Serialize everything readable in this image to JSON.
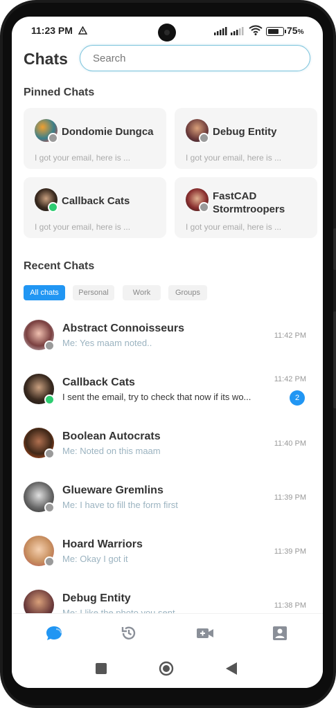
{
  "status": {
    "time": "11:23 PM",
    "battery": "75"
  },
  "header": {
    "title": "Chats",
    "search_placeholder": "Search"
  },
  "pinned": {
    "heading": "Pinned Chats",
    "items": [
      {
        "name": "Dondomie Dungca",
        "message": "I got your email, here is ...",
        "online": false
      },
      {
        "name": "Debug Entity",
        "message": "I got your email, here is ...",
        "online": false
      },
      {
        "name": "Callback Cats",
        "message": "I got your email, here is ...",
        "online": true
      },
      {
        "name": "FastCAD Stormtroopers",
        "message": "I got your email, here is ...",
        "online": false
      }
    ]
  },
  "recent": {
    "heading": "Recent Chats",
    "filters": [
      "All chats",
      "Personal",
      "Work",
      "Groups"
    ],
    "items": [
      {
        "name": "Abstract Connoisseurs",
        "message": "Me: Yes maam noted..",
        "time": "11:42 PM",
        "online": false
      },
      {
        "name": "Callback Cats",
        "message": "I sent the email, try to check that now if its wo...",
        "time": "11:42 PM",
        "badge": "2",
        "online": true
      },
      {
        "name": "Boolean Autocrats",
        "message": "Me: Noted on this maam",
        "time": "11:40 PM",
        "online": false
      },
      {
        "name": "Glueware Gremlins",
        "message": "Me: I have to fill the form first",
        "time": "11:39 PM",
        "online": false
      },
      {
        "name": "Hoard Warriors",
        "message": "Me: Okay I got it",
        "time": "11:39 PM",
        "online": false
      },
      {
        "name": "Debug Entity",
        "message": "Me: I like the photo you sent",
        "time": "11:38 PM",
        "online": false
      }
    ]
  },
  "tabs": [
    "chat-bubble-icon",
    "history-icon",
    "video-call-icon",
    "contact-icon"
  ],
  "colors": {
    "accent": "#2196f3",
    "online": "#2ecc71",
    "offline": "#9a9a9a"
  }
}
